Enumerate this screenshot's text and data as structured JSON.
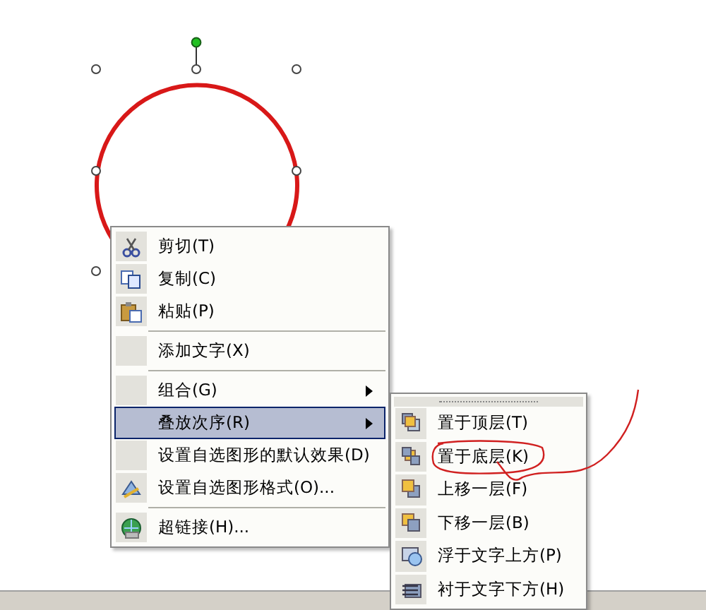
{
  "context_menu": {
    "items": [
      {
        "kind": "item",
        "label": "剪切(T)",
        "submenu": false,
        "selected": false
      },
      {
        "kind": "item",
        "label": "复制(C)",
        "submenu": false,
        "selected": false
      },
      {
        "kind": "item",
        "label": "粘贴(P)",
        "submenu": false,
        "selected": false
      },
      {
        "kind": "separator"
      },
      {
        "kind": "item",
        "label": "添加文字(X)",
        "submenu": false,
        "selected": false
      },
      {
        "kind": "separator"
      },
      {
        "kind": "item",
        "label": "组合(G)",
        "submenu": true,
        "selected": false
      },
      {
        "kind": "item",
        "label": "叠放次序(R)",
        "submenu": true,
        "selected": true
      },
      {
        "kind": "item",
        "label": "设置自选图形的默认效果(D)",
        "submenu": false,
        "selected": false
      },
      {
        "kind": "item",
        "label": "设置自选图形格式(O)...",
        "submenu": false,
        "selected": false
      },
      {
        "kind": "separator"
      },
      {
        "kind": "item",
        "label": "超链接(H)...",
        "submenu": false,
        "selected": false
      }
    ]
  },
  "submenu": {
    "items": [
      {
        "label": "置于顶层(T)",
        "circled": false
      },
      {
        "label": "置于底层(K)",
        "circled": true
      },
      {
        "label": "上移一层(F)",
        "circled": false
      },
      {
        "label": "下移一层(B)",
        "circled": false
      },
      {
        "label": "浮于文字上方(P)",
        "circled": false
      },
      {
        "label": "衬于文字下方(H)",
        "circled": false
      }
    ]
  }
}
